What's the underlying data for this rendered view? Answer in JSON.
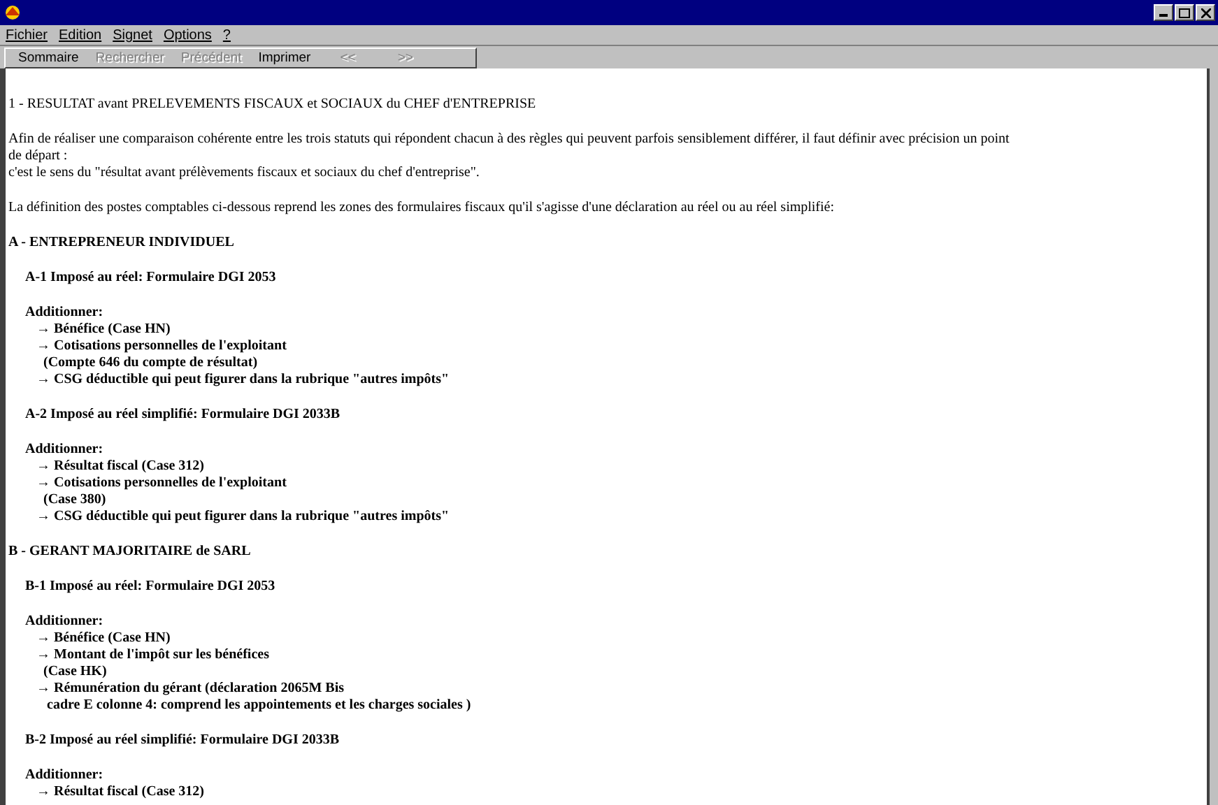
{
  "menu": [
    "Fichier",
    "Edition",
    "Signet",
    "Options",
    "?"
  ],
  "toolbar": [
    {
      "label": "Sommaire",
      "disabled": false
    },
    {
      "label": "Rechercher",
      "disabled": true
    },
    {
      "label": "Précédent",
      "disabled": true
    },
    {
      "label": "Imprimer",
      "disabled": false
    },
    {
      "label": "<<",
      "disabled": true
    },
    {
      "label": ">>",
      "disabled": true
    }
  ],
  "content": [
    {
      "kind": "heading",
      "lines": [
        "1 - RESULTAT avant PRELEVEMENTS FISCAUX et SOCIAUX du CHEF d'ENTREPRISE"
      ]
    },
    {
      "kind": "paragraph",
      "lines": [
        "Afin de réaliser une comparaison cohérente entre les trois statuts qui répondent chacun à des règles qui peuvent parfois sensiblement différer, il faut définir avec précision un point",
        "de départ :",
        "c'est le sens du \"résultat avant prélèvements fiscaux et sociaux du chef d'entreprise\"."
      ]
    },
    {
      "kind": "paragraph",
      "lines": [
        "La définition des postes comptables ci-dessous reprend les zones des formulaires fiscaux qu'il s'agisse d'une déclaration au réel ou au réel simplifié:"
      ]
    },
    {
      "kind": "section",
      "lines": [
        "A - ENTREPRENEUR INDIVIDUEL"
      ]
    },
    {
      "kind": "subsection",
      "lines": [
        "A-1 Imposé au réel: Formulaire DGI 2053"
      ]
    },
    {
      "kind": "list",
      "lines": [
        "Additionner:",
        "→ Bénéfice (Case HN)",
        "→ Cotisations personnelles de l'exploitant",
        "  (Compte 646 du compte de résultat)",
        "→ CSG déductible qui peut figurer dans la rubrique \"autres impôts\""
      ]
    },
    {
      "kind": "subsection",
      "lines": [
        "A-2 Imposé au réel simplifié: Formulaire DGI 2033B"
      ]
    },
    {
      "kind": "list",
      "lines": [
        "Additionner:",
        "→ Résultat fiscal (Case 312)",
        "→ Cotisations personnelles de l'exploitant",
        "  (Case 380)",
        "→ CSG déductible qui peut figurer dans la rubrique \"autres impôts\""
      ]
    },
    {
      "kind": "section",
      "lines": [
        "B - GERANT MAJORITAIRE de SARL"
      ]
    },
    {
      "kind": "subsection",
      "lines": [
        "B-1 Imposé au réel: Formulaire DGI 2053"
      ]
    },
    {
      "kind": "list",
      "lines": [
        "Additionner:",
        "→ Bénéfice (Case HN)",
        "→ Montant de l'impôt sur les bénéfices",
        "  (Case HK)",
        "→ Rémunération du gérant (déclaration 2065M Bis",
        "   cadre E colonne 4: comprend les appointements et les charges sociales )"
      ]
    },
    {
      "kind": "subsection",
      "lines": [
        "B-2 Imposé au réel simplifié: Formulaire DGI 2033B"
      ]
    },
    {
      "kind": "list",
      "lines": [
        "Additionner:",
        "→ Résultat fiscal (Case 312)"
      ]
    }
  ]
}
